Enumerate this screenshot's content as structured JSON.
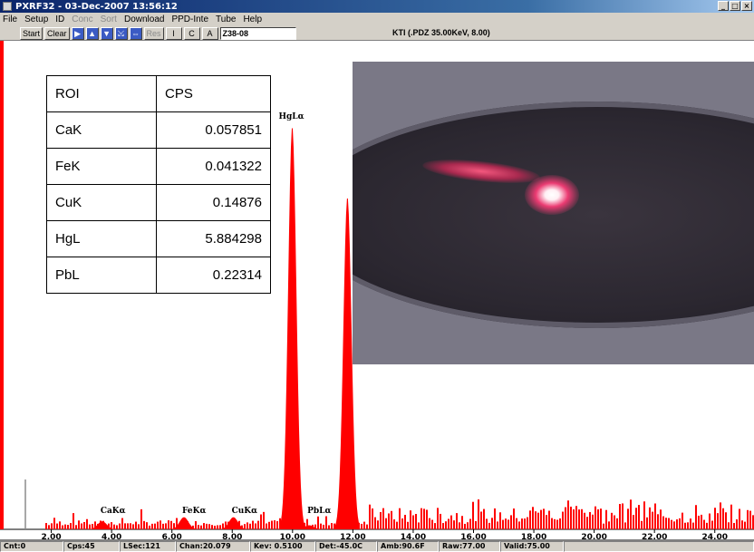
{
  "window": {
    "title": "PXRF32 - 03-Dec-2007 13:56:12",
    "buttons": [
      "_",
      "□",
      "×"
    ]
  },
  "menu": [
    {
      "label": "File",
      "enabled": true
    },
    {
      "label": "Setup",
      "enabled": true
    },
    {
      "label": "ID",
      "enabled": true
    },
    {
      "label": "Conc",
      "enabled": false
    },
    {
      "label": "Sort",
      "enabled": false
    },
    {
      "label": "Download",
      "enabled": true
    },
    {
      "label": "PPD-Inte",
      "enabled": true
    },
    {
      "label": "Tube",
      "enabled": true
    },
    {
      "label": "Help",
      "enabled": true
    }
  ],
  "toolbar": {
    "start": "Start",
    "clear": "Clear",
    "nav_icons": [
      "arrow-right-icon",
      "arrow-up-icon",
      "arrow-down-icon",
      "zoom-in-icon",
      "zoom-out-icon"
    ],
    "res": "Res",
    "i_btn": "I",
    "c_btn": "C",
    "a_btn": "A",
    "sample_id": "Z38-08",
    "kti": "KTI (.PDZ 35.00KeV, 8.00)"
  },
  "roi_table": {
    "headers": [
      "ROI",
      "CPS"
    ],
    "rows": [
      [
        "CaK",
        "0.057851"
      ],
      [
        "FeK",
        "0.041322"
      ],
      [
        "CuK",
        "0.14876"
      ],
      [
        "HgL",
        "5.884298"
      ],
      [
        "PbL",
        "0.22314"
      ]
    ]
  },
  "chart_data": {
    "type": "bar",
    "xlabel": "",
    "ylabel": "",
    "xlim": [
      0.3,
      25.3
    ],
    "x_ticks": [
      "2.00",
      "4.00",
      "6.00",
      "8.00",
      "10.00",
      "12.00",
      "14.00",
      "16.00",
      "18.00",
      "20.00",
      "22.00",
      "24.00"
    ],
    "peaks": [
      {
        "label": "CaKα",
        "kev": 3.69,
        "height": 0.008
      },
      {
        "label": "FeKα",
        "kev": 6.4,
        "height": 0.012
      },
      {
        "label": "CuKα",
        "kev": 8.04,
        "height": 0.012
      },
      {
        "label": "HgLα",
        "kev": 9.99,
        "height": 0.4
      },
      {
        "label": "PbLα",
        "kev": 10.55,
        "height": 0.004
      },
      {
        "label": "",
        "kev": 11.82,
        "height": 0.33
      }
    ],
    "color": "#ff0000"
  },
  "status": [
    "Cnt:0",
    "Cps:45",
    "LSec:121",
    "Chan:20.079",
    "Kev: 0.5100",
    "Det:-45.0C",
    "Amb:90.6F",
    "Raw:77.00",
    "Valid:75.00"
  ]
}
